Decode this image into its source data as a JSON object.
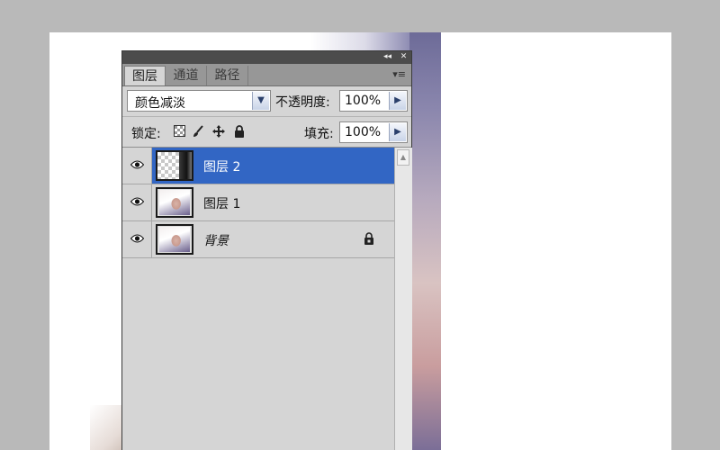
{
  "panel": {
    "titlebar": {
      "collapse_glyph": "◂◂",
      "close_glyph": "✕"
    },
    "tabs": [
      {
        "label": "图层",
        "active": true
      },
      {
        "label": "通道",
        "active": false
      },
      {
        "label": "路径",
        "active": false
      }
    ],
    "menu_glyph": "▾≡",
    "blend_mode": {
      "value": "颜色减淡",
      "arrow": "▼"
    },
    "opacity": {
      "label": "不透明度:",
      "value": "100%",
      "arrow": "▶"
    },
    "lock": {
      "label": "锁定:",
      "icons": [
        "lock-transparent-icon",
        "lock-image-icon",
        "lock-position-icon",
        "lock-all-icon"
      ]
    },
    "fill": {
      "label": "填充:",
      "value": "100%",
      "arrow": "▶"
    },
    "layers": [
      {
        "name": "图层 2",
        "selected": true,
        "visible": true,
        "thumbnail": "transparent-bw",
        "locked": false,
        "italic": false
      },
      {
        "name": "图层 1",
        "selected": false,
        "visible": true,
        "thumbnail": "portrait",
        "locked": false,
        "italic": false
      },
      {
        "name": "背景",
        "selected": false,
        "visible": true,
        "thumbnail": "portrait",
        "locked": true,
        "italic": true
      }
    ],
    "scroll_up_glyph": "▲"
  },
  "colors": {
    "selection": "#3266c4",
    "panel_bg": "#d5d5d5",
    "titlebar": "#4c4c4c",
    "canvas_bg": "#b9b9b9"
  }
}
